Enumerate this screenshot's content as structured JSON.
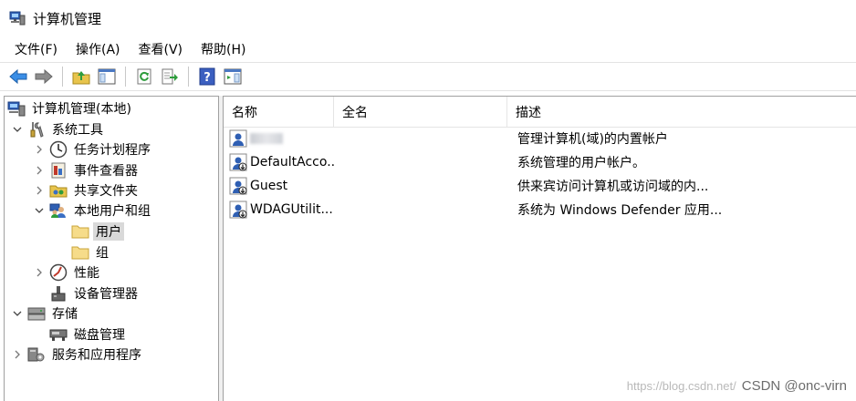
{
  "window": {
    "title": "计算机管理"
  },
  "menu": [
    "文件(F)",
    "操作(A)",
    "查看(V)",
    "帮助(H)"
  ],
  "toolbar": {
    "buttons": [
      "back-arrow-icon",
      "forward-arrow-icon",
      "up-folder-icon",
      "show-hide-tree-icon",
      "refresh-icon",
      "export-list-icon",
      "help-icon",
      "action-pane-icon"
    ]
  },
  "tree": [
    {
      "label": "计算机管理(本地)",
      "icon": "computer-management-icon",
      "level": 0,
      "expander": "none"
    },
    {
      "label": "系统工具",
      "icon": "system-tools-icon",
      "level": 1,
      "expander": "expanded"
    },
    {
      "label": "任务计划程序",
      "icon": "clock-icon",
      "level": 2,
      "expander": "collapsed"
    },
    {
      "label": "事件查看器",
      "icon": "event-viewer-icon",
      "level": 2,
      "expander": "collapsed"
    },
    {
      "label": "共享文件夹",
      "icon": "shared-folder-icon",
      "level": 2,
      "expander": "collapsed"
    },
    {
      "label": "本地用户和组",
      "icon": "users-groups-icon",
      "level": 2,
      "expander": "expanded"
    },
    {
      "label": "用户",
      "icon": "folder-icon",
      "level": 3,
      "expander": "none",
      "selected": true
    },
    {
      "label": "组",
      "icon": "folder-icon",
      "level": 3,
      "expander": "none"
    },
    {
      "label": "性能",
      "icon": "performance-icon",
      "level": 2,
      "expander": "collapsed"
    },
    {
      "label": "设备管理器",
      "icon": "device-manager-icon",
      "level": 2,
      "expander": "none"
    },
    {
      "label": "存储",
      "icon": "storage-icon",
      "level": 1,
      "expander": "expanded"
    },
    {
      "label": "磁盘管理",
      "icon": "disk-management-icon",
      "level": 2,
      "expander": "none"
    },
    {
      "label": "服务和应用程序",
      "icon": "services-apps-icon",
      "level": 1,
      "expander": "collapsed"
    }
  ],
  "list": {
    "columns": [
      "名称",
      "全名",
      "描述"
    ],
    "rows": [
      {
        "name": "",
        "name_blurred": true,
        "full_name": "",
        "description": "管理计算机(域)的内置帐户"
      },
      {
        "name": "DefaultAcco...",
        "full_name": "",
        "description": "系统管理的用户帐户。"
      },
      {
        "name": "Guest",
        "full_name": "",
        "description": "供来宾访问计算机或访问域的内..."
      },
      {
        "name": "WDAGUtilit...",
        "full_name": "",
        "description": "系统为 Windows Defender 应用..."
      }
    ]
  },
  "watermark": {
    "url": "https://blog.csdn.net/",
    "text": "CSDN @onc-virn"
  }
}
